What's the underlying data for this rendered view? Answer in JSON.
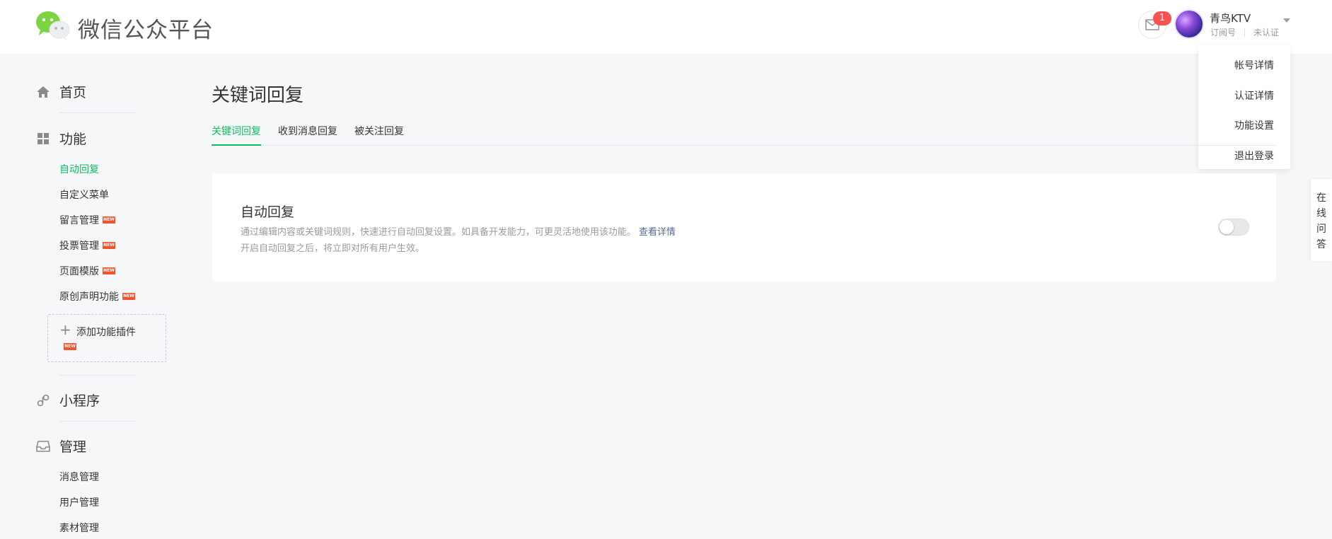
{
  "header": {
    "brand": "微信公众平台",
    "mail_badge": "1",
    "account_name": "青鸟KTV",
    "account_type": "订阅号",
    "verify_status": "未认证"
  },
  "dropdown": {
    "items": [
      "帐号详情",
      "认证详情",
      "功能设置",
      "退出登录"
    ]
  },
  "sidebar": {
    "home": "首页",
    "features": "功能",
    "feature_items": [
      {
        "label": "自动回复"
      },
      {
        "label": "自定义菜单"
      },
      {
        "label": "留言管理",
        "tag": "NEW"
      },
      {
        "label": "投票管理",
        "tag": "NEW"
      },
      {
        "label": "页面模版",
        "tag": "NEW"
      },
      {
        "label": "原创声明功能",
        "tag": "NEW"
      }
    ],
    "add_plugin": "添加功能插件",
    "add_plugin_tag": "NEW",
    "miniprogram": "小程序",
    "manage": "管理",
    "manage_items": [
      "消息管理",
      "用户管理",
      "素材管理"
    ]
  },
  "main": {
    "title": "关键词回复",
    "tabs": [
      "关键词回复",
      "收到消息回复",
      "被关注回复"
    ],
    "card": {
      "title": "自动回复",
      "desc": "通过编辑内容或关键词规则，快速进行自动回复设置。如具备开发能力，可更灵活地使用该功能。",
      "link": "查看详情",
      "desc2": "开启自动回复之后，将立即对所有用户生效。",
      "toggle_on": false
    }
  },
  "float": {
    "chars": [
      "在",
      "线",
      "问",
      "答"
    ]
  },
  "colors": {
    "accent": "#07c160",
    "link": "#576b95",
    "badge": "#fa5151",
    "new_tag": "#f0532e"
  }
}
